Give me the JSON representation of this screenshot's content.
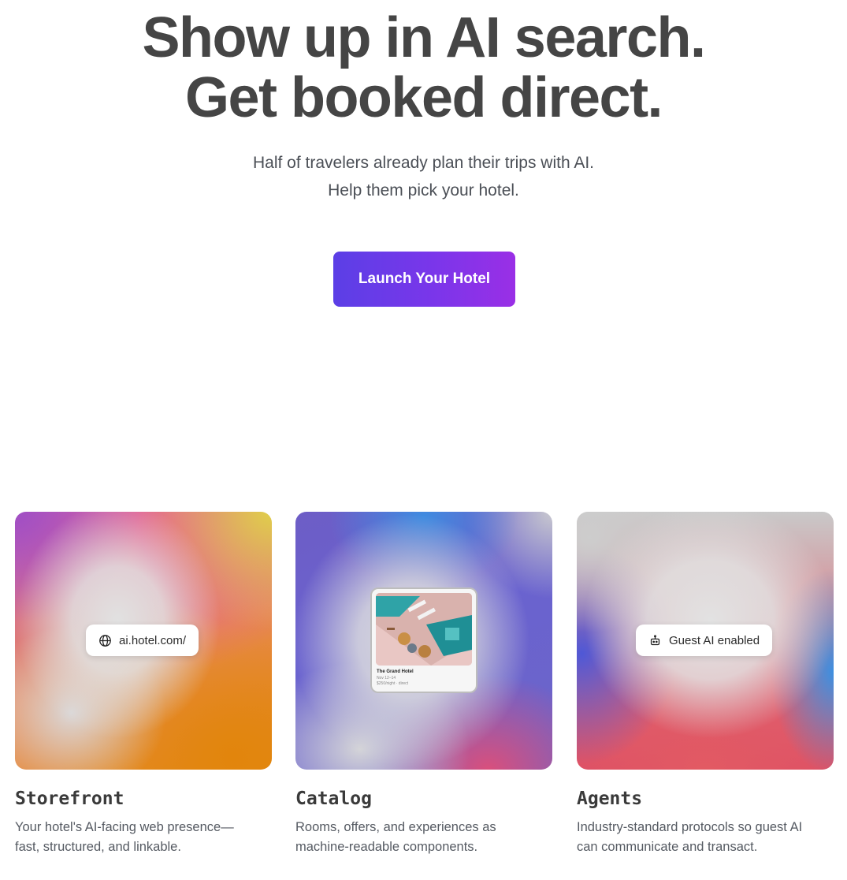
{
  "hero": {
    "headline_line1": "Show up in AI search.",
    "headline_line2": "Get booked direct.",
    "subtext_line1": "Half of travelers already plan their trips with AI.",
    "subtext_line2": "Help them pick your hotel.",
    "cta_label": "Launch Your Hotel"
  },
  "colors": {
    "cta_gradient_start": "#5b3fe6",
    "cta_gradient_end": "#9a2fe6",
    "headline": "#454545"
  },
  "features": [
    {
      "title": "Storefront",
      "description_line1": "Your hotel's AI-facing web presence—",
      "description_line2": "fast, structured, and linkable.",
      "pill_icon": "globe-icon",
      "pill_text": "ai.hotel.com/"
    },
    {
      "title": "Catalog",
      "description_line1": "Rooms, offers, and experiences as",
      "description_line2": "machine-readable components.",
      "hotel_card": {
        "name": "The Grand Hotel",
        "dates": "Nov 12–14",
        "price": "$250/night · direct"
      }
    },
    {
      "title": "Agents",
      "description_line1": "Industry-standard protocols so guest AI",
      "description_line2": "can communicate and transact.",
      "pill_icon": "robot-icon",
      "pill_text": "Guest AI enabled"
    }
  ]
}
